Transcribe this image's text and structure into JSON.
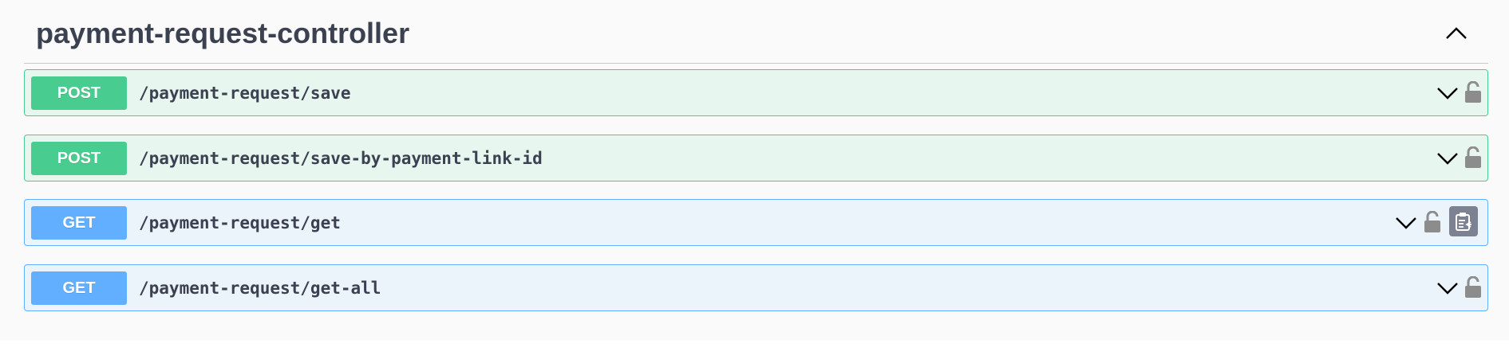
{
  "tag": {
    "title": "payment-request-controller",
    "collapse_icon": "chevron-up-icon"
  },
  "colors": {
    "post": "#49cc90",
    "post_bg": "#e8f6f0",
    "get": "#61affe",
    "get_bg": "#ebf3fb",
    "text": "#3b4151",
    "lock": "#8c8c8c",
    "copy_button": "#7d8293"
  },
  "operations": [
    {
      "method": "POST",
      "path": "/payment-request/save",
      "icons": [
        "chevron-down-icon",
        "lock-icon"
      ]
    },
    {
      "method": "POST",
      "path": "/payment-request/save-by-payment-link-id",
      "icons": [
        "chevron-down-icon",
        "lock-icon"
      ]
    },
    {
      "method": "GET",
      "path": "/payment-request/get",
      "icons": [
        "chevron-down-icon",
        "lock-icon",
        "copy-to-clipboard-icon"
      ]
    },
    {
      "method": "GET",
      "path": "/payment-request/get-all",
      "icons": [
        "chevron-down-icon",
        "lock-icon"
      ]
    }
  ]
}
